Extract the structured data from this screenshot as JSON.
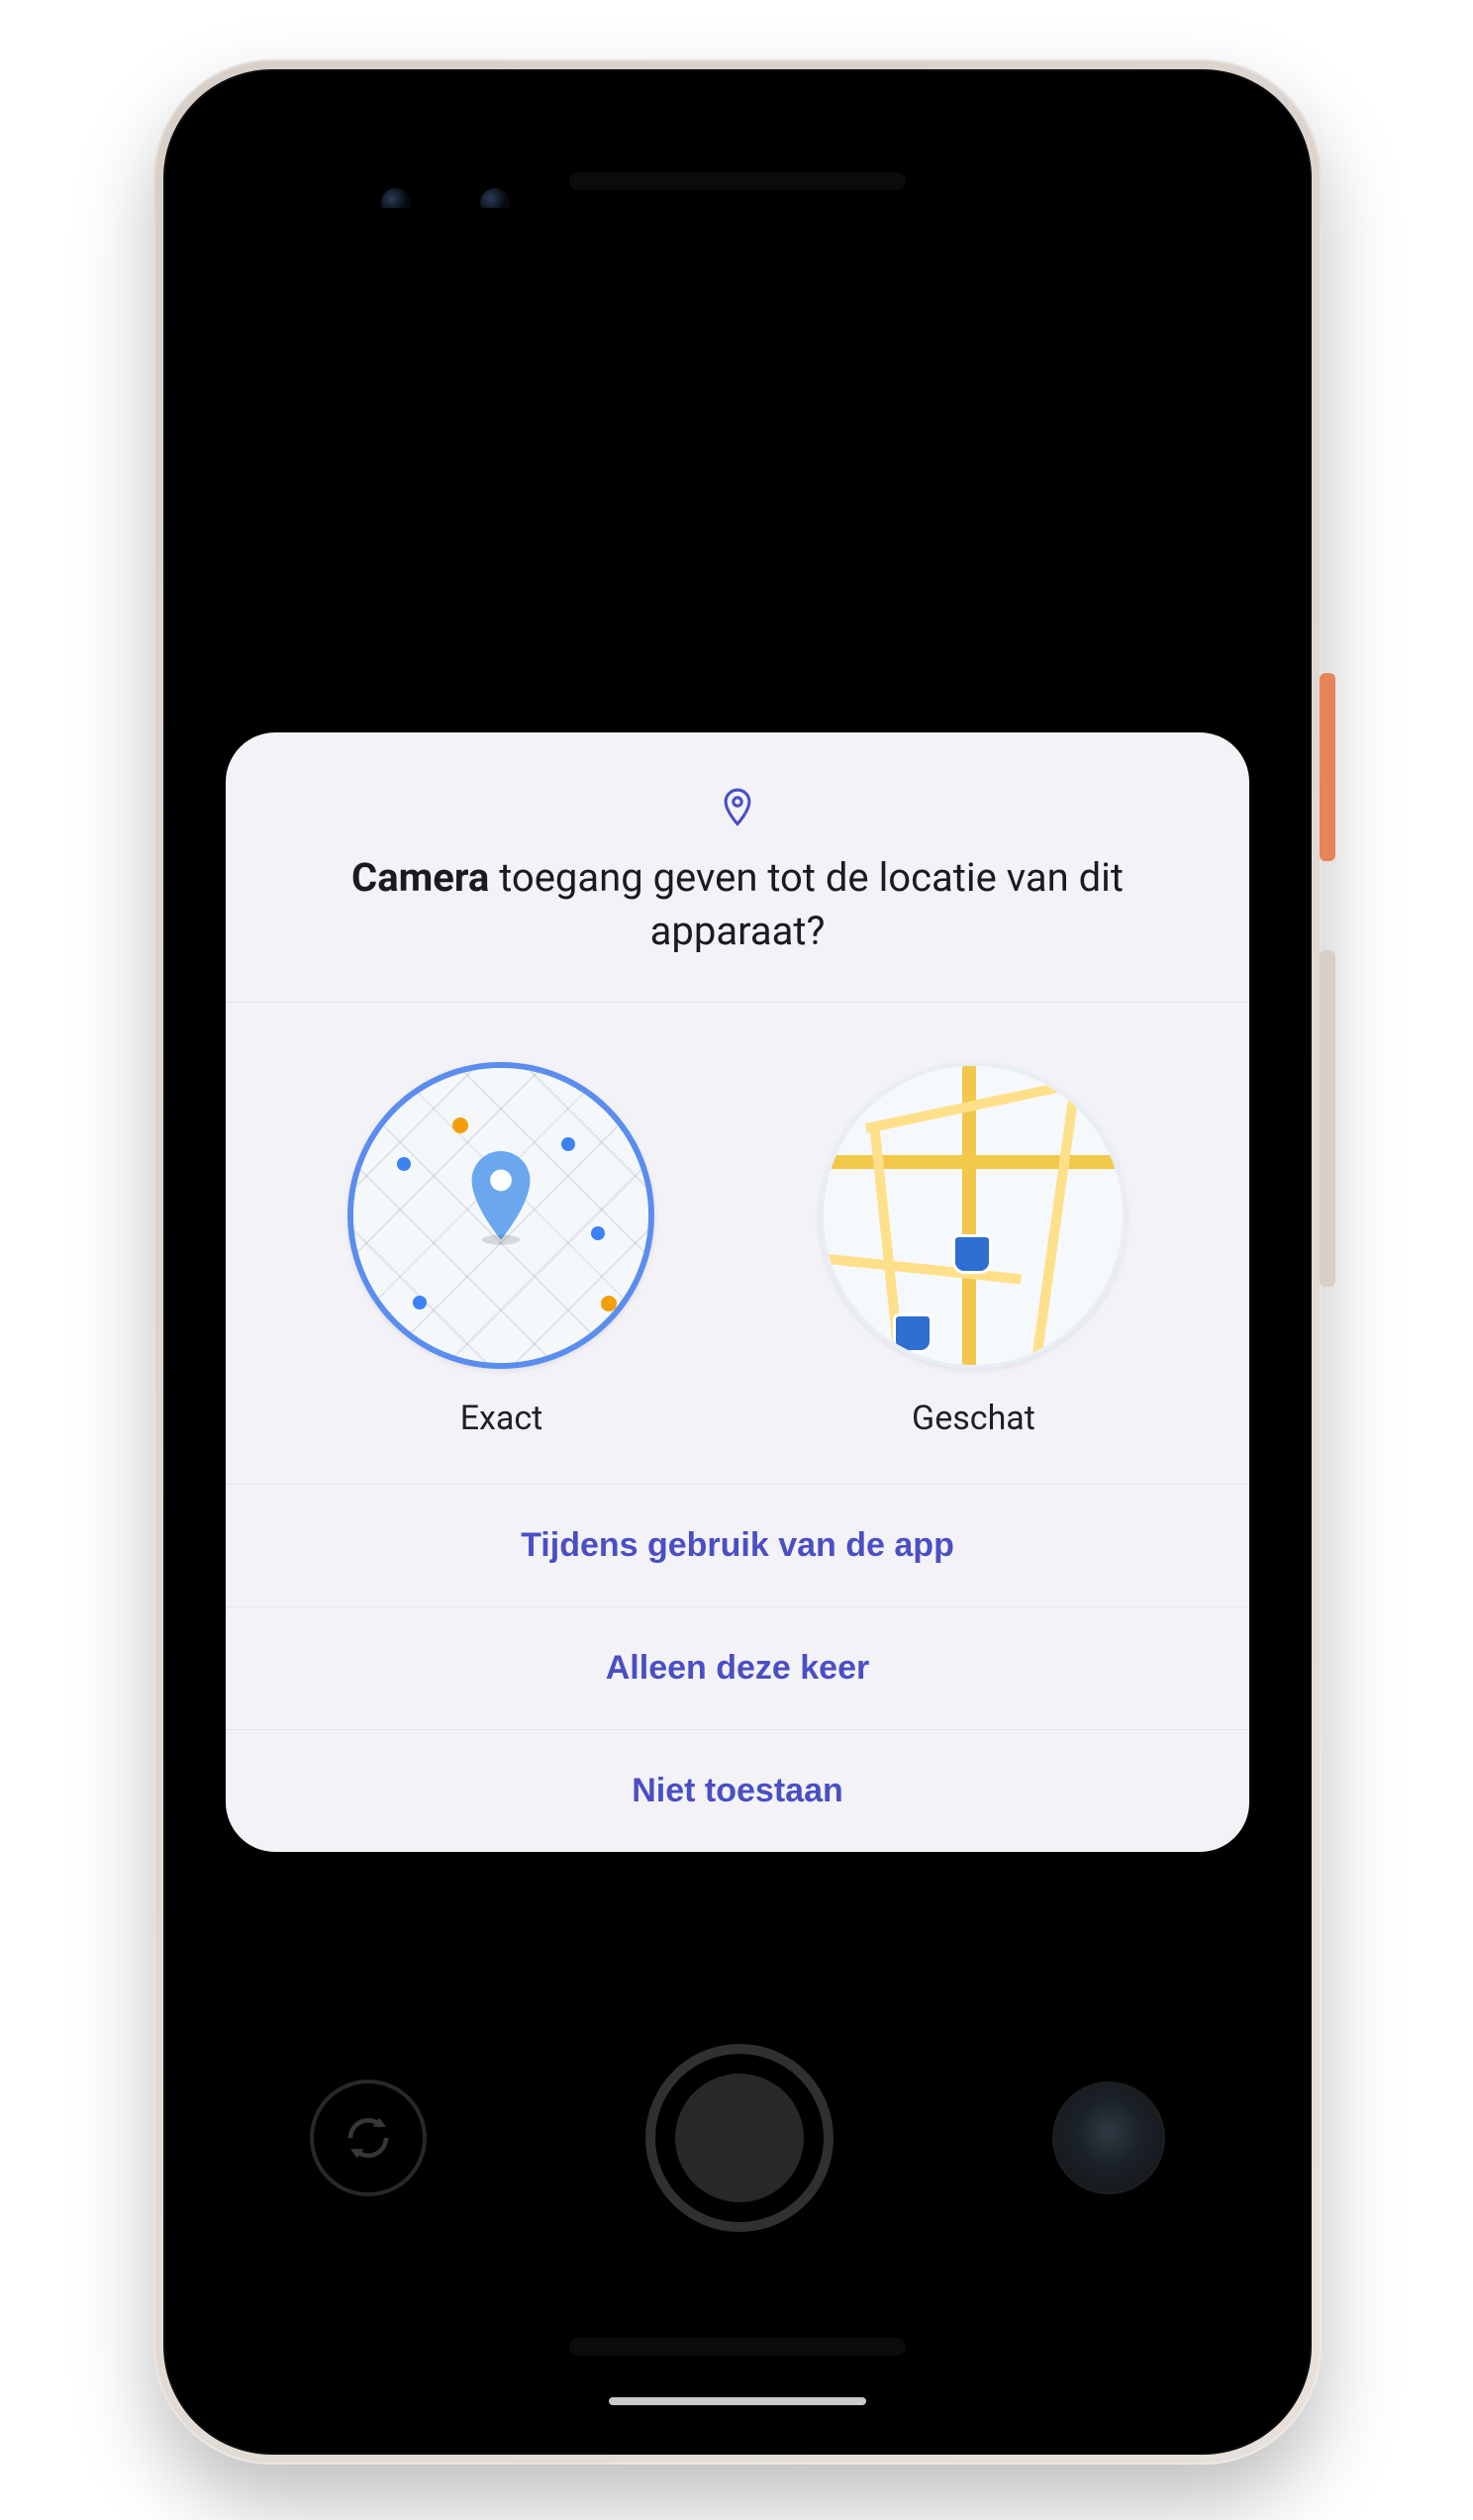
{
  "dialog": {
    "app_name": "Camera",
    "title_rest": " toegang geven tot de locatie van dit apparaat?",
    "accuracy": {
      "exact_label": "Exact",
      "approx_label": "Geschat"
    },
    "actions": {
      "while_using": "Tijdens gebruik van de app",
      "only_this_time": "Alleen deze keer",
      "deny": "Niet toestaan"
    }
  }
}
